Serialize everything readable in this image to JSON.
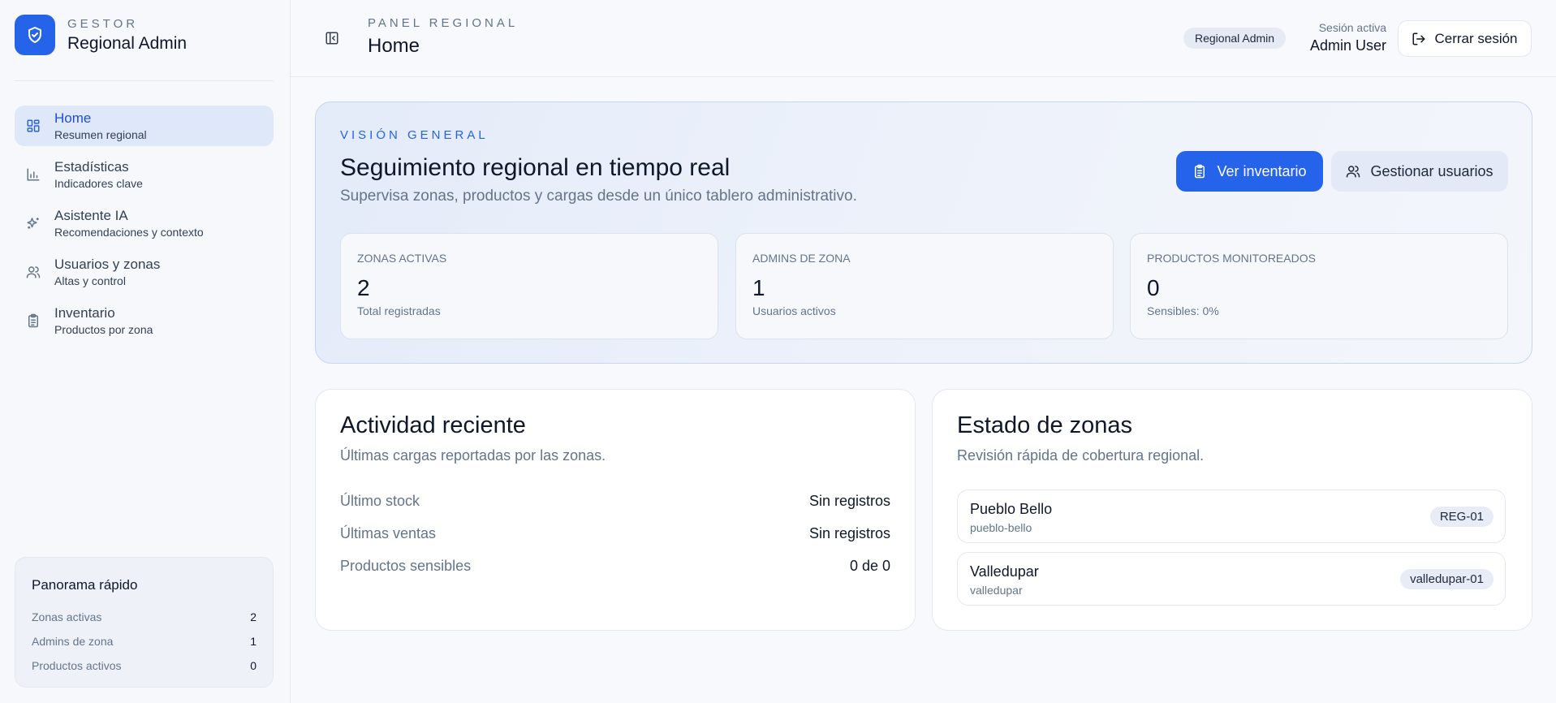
{
  "brand": {
    "kicker": "GESTOR",
    "title": "Regional Admin"
  },
  "nav": {
    "items": [
      {
        "label": "Home",
        "sub": "Resumen regional",
        "icon": "grid-icon",
        "active": true
      },
      {
        "label": "Estadísticas",
        "sub": "Indicadores clave",
        "icon": "bar-chart-icon",
        "active": false
      },
      {
        "label": "Asistente IA",
        "sub": "Recomendaciones y contexto",
        "icon": "sparkles-icon",
        "active": false
      },
      {
        "label": "Usuarios y zonas",
        "sub": "Altas y control",
        "icon": "users-icon",
        "active": false
      },
      {
        "label": "Inventario",
        "sub": "Productos por zona",
        "icon": "clipboard-icon",
        "active": false
      }
    ]
  },
  "quick": {
    "title": "Panorama rápido",
    "rows": [
      {
        "label": "Zonas activas",
        "value": "2"
      },
      {
        "label": "Admins de zona",
        "value": "1"
      },
      {
        "label": "Productos activos",
        "value": "0"
      }
    ]
  },
  "header": {
    "kicker": "PANEL REGIONAL",
    "title": "Home",
    "role_badge": "Regional Admin",
    "session_label": "Sesión activa",
    "session_user": "Admin User",
    "logout_label": "Cerrar sesión"
  },
  "hero": {
    "kicker": "VISIÓN GENERAL",
    "title": "Seguimiento regional en tiempo real",
    "subtitle": "Supervisa zonas, productos y cargas desde un único tablero administrativo.",
    "primary_button": "Ver inventario",
    "secondary_button": "Gestionar usuarios",
    "stats": [
      {
        "label": "ZONAS ACTIVAS",
        "value": "2",
        "sub": "Total registradas"
      },
      {
        "label": "ADMINS DE ZONA",
        "value": "1",
        "sub": "Usuarios activos"
      },
      {
        "label": "PRODUCTOS MONITOREADOS",
        "value": "0",
        "sub": "Sensibles: 0%"
      }
    ]
  },
  "activity": {
    "title": "Actividad reciente",
    "subtitle": "Últimas cargas reportadas por las zonas.",
    "rows": [
      {
        "label": "Último stock",
        "value": "Sin registros"
      },
      {
        "label": "Últimas ventas",
        "value": "Sin registros"
      },
      {
        "label": "Productos sensibles",
        "value": "0 de 0"
      }
    ]
  },
  "zones": {
    "title": "Estado de zonas",
    "subtitle": "Revisión rápida de cobertura regional.",
    "items": [
      {
        "name": "Pueblo Bello",
        "slug": "pueblo-bello",
        "code": "REG-01"
      },
      {
        "name": "Valledupar",
        "slug": "valledupar",
        "code": "valledupar-01"
      }
    ]
  },
  "colors": {
    "accent": "#2563eb",
    "active_nav_bg": "#dfe8f8",
    "text": "#0f172a",
    "muted": "#64748b"
  }
}
